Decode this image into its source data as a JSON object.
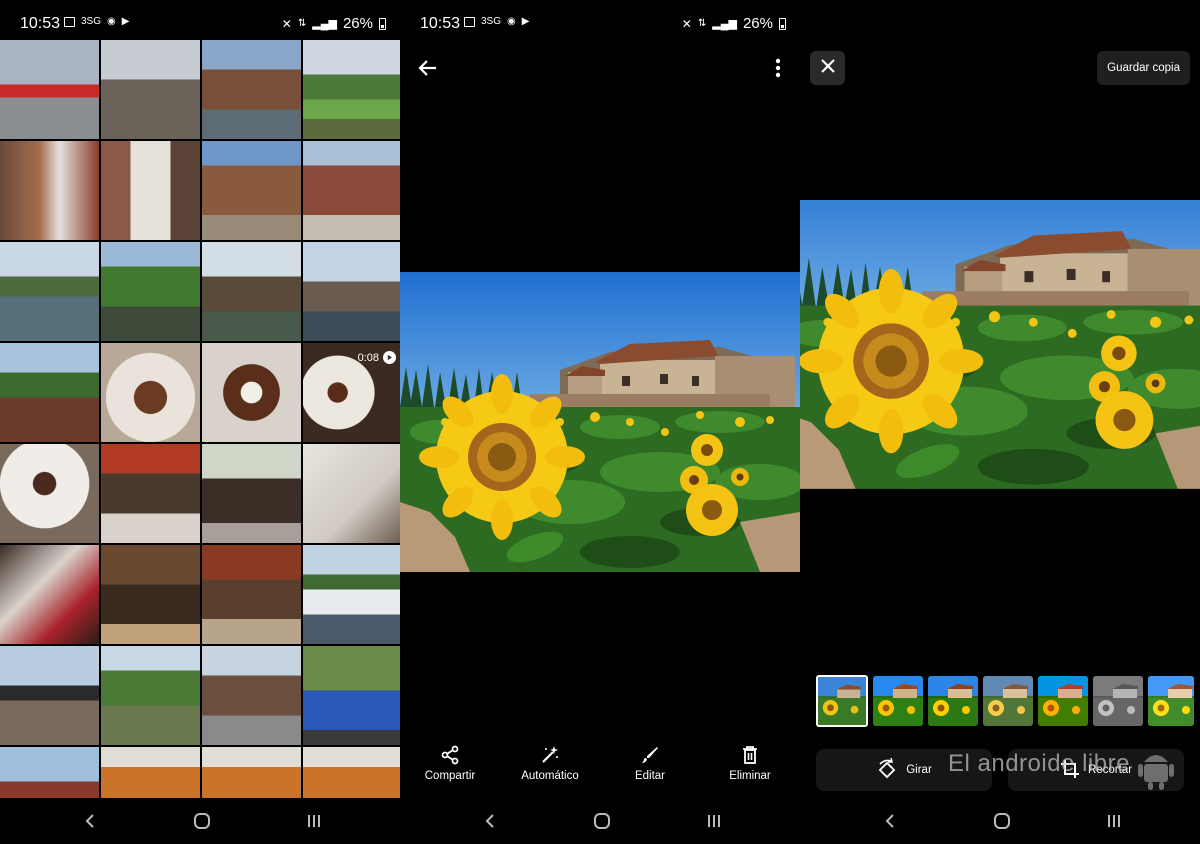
{
  "status": {
    "time": "10:53",
    "network": "3SG",
    "battery": "26%"
  },
  "gallery": {
    "video_duration": "0:08"
  },
  "viewer": {
    "actions": [
      {
        "label": "Compartir",
        "icon": "share-icon"
      },
      {
        "label": "Automático",
        "icon": "magic-wand-icon"
      },
      {
        "label": "Editar",
        "icon": "pencil-icon"
      },
      {
        "label": "Eliminar",
        "icon": "trash-icon"
      }
    ]
  },
  "editor": {
    "save_label": "Guardar copia",
    "rotate_label": "Girar",
    "crop_label": "Recortar"
  },
  "watermark": "El androide libre",
  "colors": {
    "background": "#000000",
    "button_bg": "#1f1f1f",
    "sky": "#2e7fd6",
    "sunflower": "#f3c613"
  }
}
